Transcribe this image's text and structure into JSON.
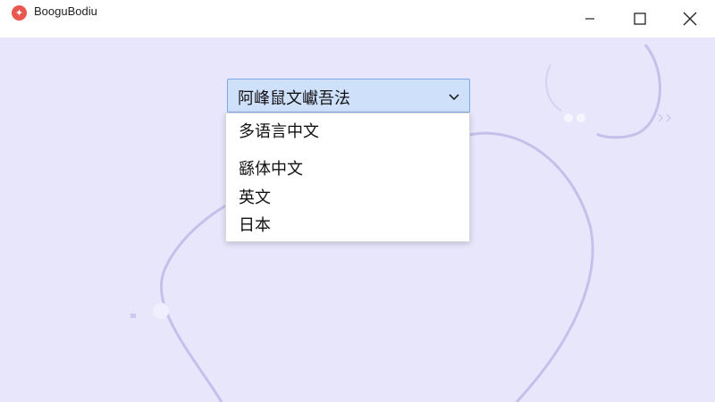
{
  "window": {
    "title": "BooguBodiu",
    "icon": "app-logo-icon",
    "controls": {
      "minimize_icon": "minimize-icon",
      "maximize_icon": "maximize-icon",
      "close_icon": "close-icon"
    }
  },
  "language_select": {
    "selected": "阿峰鼠文巘吾法",
    "chevron_icon": "chevron-down-icon",
    "options": [
      "多语言中文",
      "繇体中文",
      "英文",
      "日本"
    ]
  },
  "colors": {
    "background": "#e8e6fb",
    "accent": "#7fa7e6",
    "selected_fill": "#cfe0fb",
    "logo": "#e8584f"
  }
}
